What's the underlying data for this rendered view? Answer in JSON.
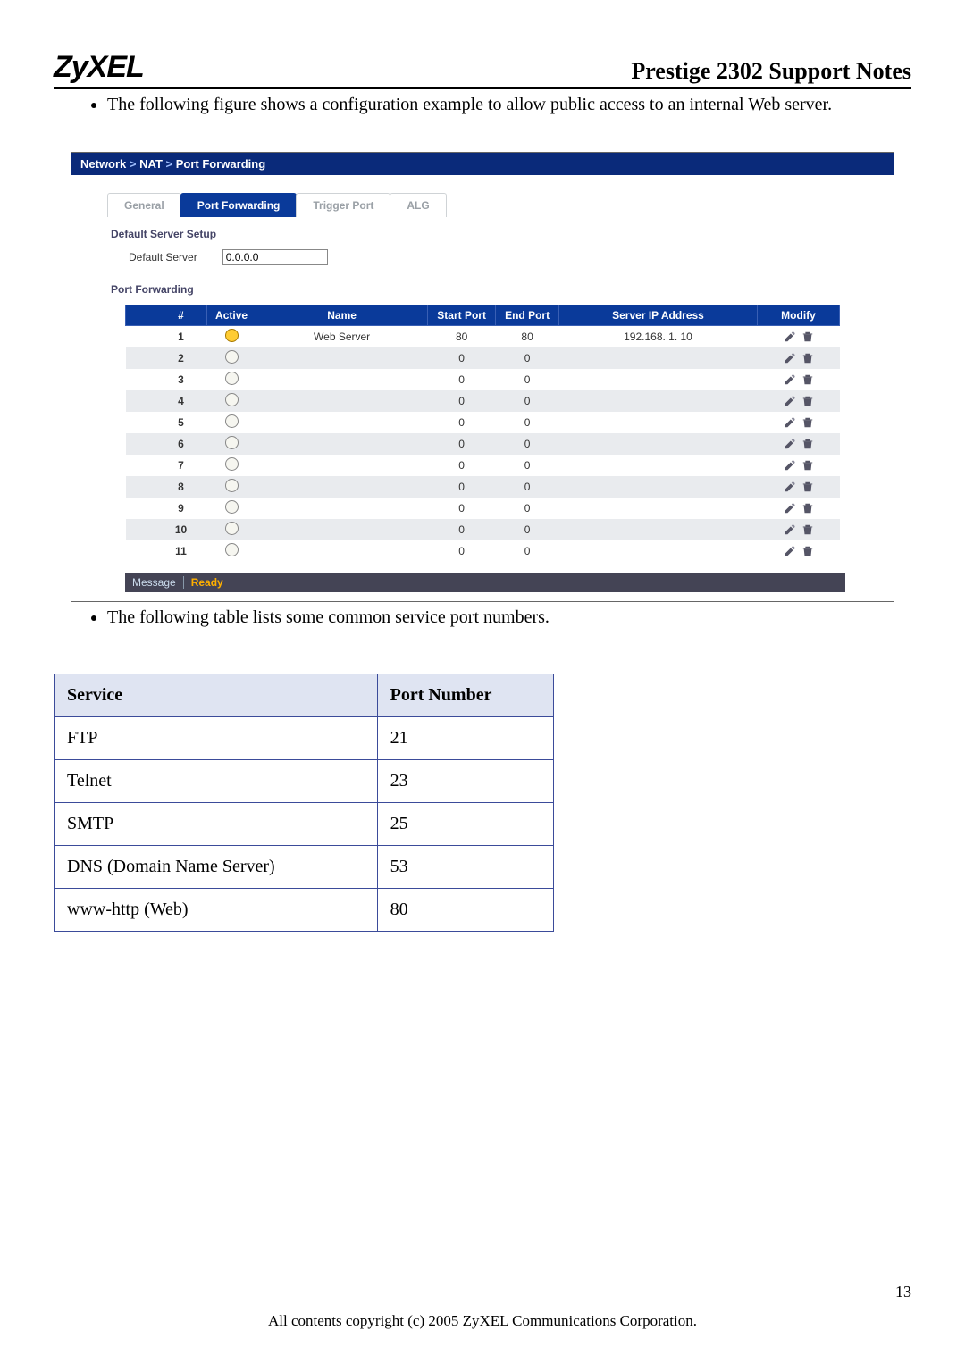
{
  "header": {
    "logo_text": "ZyXEL",
    "title": "Prestige 2302 Support Notes"
  },
  "paragraphs": {
    "p1": "The following figure shows a configuration example to allow public access to an internal Web server.",
    "p2": "The following table lists some common service port numbers."
  },
  "ui": {
    "breadcrumb_prefix": "Network",
    "breadcrumb_mid": "NAT",
    "breadcrumb_leaf": "Port Forwarding",
    "tabs": [
      {
        "label": "General",
        "active": false
      },
      {
        "label": "Port Forwarding",
        "active": true
      },
      {
        "label": "Trigger Port",
        "active": false
      },
      {
        "label": "ALG",
        "active": false
      }
    ],
    "section1_title": "Default Server Setup",
    "default_server_label": "Default Server",
    "default_server_value": "0.0.0.0",
    "section2_title": "Port Forwarding",
    "columns": {
      "c0": "#",
      "c1": "Active",
      "c2": "Name",
      "c3": "Start Port",
      "c4": "End Port",
      "c5": "Server IP Address",
      "c6": "Modify"
    },
    "rows": [
      {
        "n": "1",
        "active": true,
        "name": "Web Server",
        "start": "80",
        "end": "80",
        "ip": "192.168. 1. 10"
      },
      {
        "n": "2",
        "active": false,
        "name": "",
        "start": "0",
        "end": "0",
        "ip": ""
      },
      {
        "n": "3",
        "active": false,
        "name": "",
        "start": "0",
        "end": "0",
        "ip": ""
      },
      {
        "n": "4",
        "active": false,
        "name": "",
        "start": "0",
        "end": "0",
        "ip": ""
      },
      {
        "n": "5",
        "active": false,
        "name": "",
        "start": "0",
        "end": "0",
        "ip": ""
      },
      {
        "n": "6",
        "active": false,
        "name": "",
        "start": "0",
        "end": "0",
        "ip": ""
      },
      {
        "n": "7",
        "active": false,
        "name": "",
        "start": "0",
        "end": "0",
        "ip": ""
      },
      {
        "n": "8",
        "active": false,
        "name": "",
        "start": "0",
        "end": "0",
        "ip": ""
      },
      {
        "n": "9",
        "active": false,
        "name": "",
        "start": "0",
        "end": "0",
        "ip": ""
      },
      {
        "n": "10",
        "active": false,
        "name": "",
        "start": "0",
        "end": "0",
        "ip": ""
      },
      {
        "n": "11",
        "active": false,
        "name": "",
        "start": "0",
        "end": "0",
        "ip": ""
      }
    ],
    "message_label": "Message",
    "message_value": "Ready"
  },
  "service_table": {
    "headers": {
      "c0": "Service",
      "c1": "Port Number"
    },
    "rows": [
      {
        "service": "FTP",
        "port": "21"
      },
      {
        "service": "Telnet",
        "port": "23"
      },
      {
        "service": "SMTP",
        "port": "25"
      },
      {
        "service": "DNS (Domain Name Server)",
        "port": "53"
      },
      {
        "service": "www-http (Web)",
        "port": "80"
      }
    ]
  },
  "page": {
    "number": "13",
    "copyright": "All contents copyright (c) 2005 ZyXEL Communications Corporation."
  }
}
